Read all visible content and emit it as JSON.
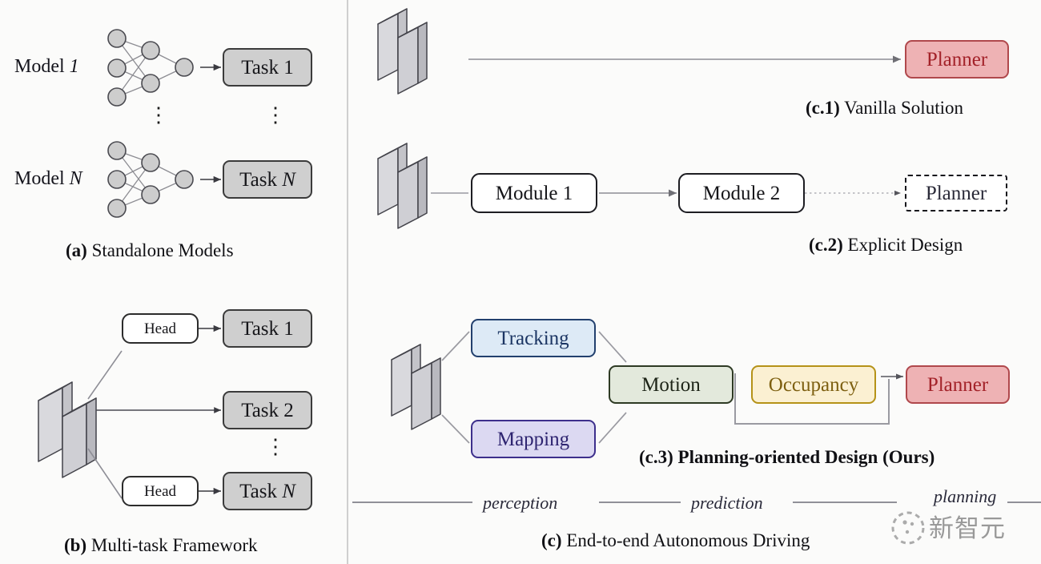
{
  "figure": {
    "background_color": "#fbfbfa",
    "divider_color": "#b9b9b9"
  },
  "panel_a": {
    "caption_prefix": "(a)",
    "caption_text": " Standalone Models",
    "rows": [
      {
        "model_label": "Model 1",
        "model_label_plain": "Model ",
        "model_label_italic": "1",
        "task_label": "Task 1"
      },
      {
        "model_label": "Model N",
        "model_label_plain": "Model ",
        "model_label_italic": "N",
        "task_label": "Task N"
      }
    ],
    "vertical_dots": "⋮"
  },
  "panel_b": {
    "caption_prefix": "(b)",
    "caption_text": " Multi-task Framework",
    "head_label": "Head",
    "tasks": [
      "Task 1",
      "Task 2",
      "Task N"
    ],
    "task_n_plain": "Task ",
    "task_n_italic": "N",
    "vertical_dots": "⋮",
    "backbone_icon": "stacked-slabs-icon"
  },
  "panel_c": {
    "caption_prefix": "(c)",
    "caption_text": " End-to-end Autonomous Driving",
    "stage_labels": [
      "perception",
      "prediction",
      "planning"
    ],
    "rows": {
      "c1": {
        "caption_prefix": "(c.1)",
        "caption_text": " Vanilla Solution",
        "backbone_icon": "stacked-slabs-icon",
        "planner_label": "Planner",
        "planner_fill": "#eeb2b4",
        "planner_border": "#b0484c",
        "planner_text_color": "#a32229"
      },
      "c2": {
        "caption_prefix": "(c.2)",
        "caption_text": " Explicit Design",
        "backbone_icon": "stacked-slabs-icon",
        "module1_label": "Module 1",
        "module2_label": "Module 2",
        "planner_label": "Planner",
        "planner_style": "dashed"
      },
      "c3": {
        "caption_prefix": "(c.3)",
        "caption_text": " Planning-oriented Design (Ours)",
        "caption_bold": true,
        "backbone_icon": "stacked-slabs-icon",
        "tracking_label": "Tracking",
        "tracking_fill": "#ddeaf6",
        "tracking_border": "#22406e",
        "mapping_label": "Mapping",
        "mapping_fill": "#dcd9f2",
        "mapping_border": "#3d2f8c",
        "motion_label": "Motion",
        "motion_fill": "#e3e9dc",
        "motion_border": "#2e3a24",
        "occupancy_label": "Occupancy",
        "occupancy_fill": "#fbf0d2",
        "occupancy_border": "#b59218",
        "planner_label": "Planner",
        "planner_fill": "#eeb2b4",
        "planner_border": "#b0484c"
      }
    }
  },
  "watermark": {
    "text": "新智元",
    "logo_icon": "circular-dotted-logo-icon"
  }
}
